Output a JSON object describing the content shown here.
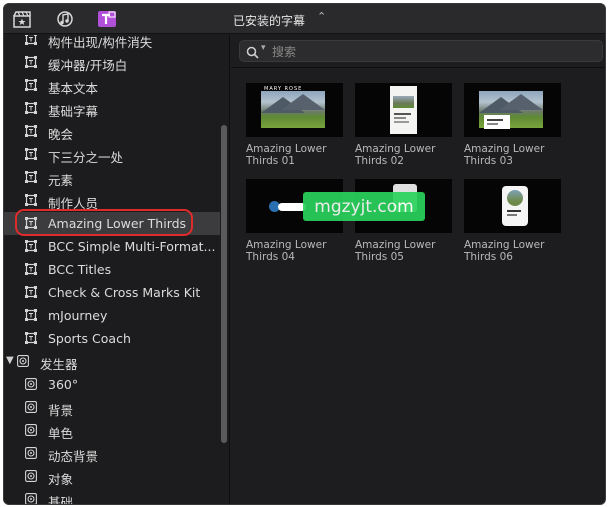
{
  "toolbar": {
    "library_title": "已安装的字幕",
    "icons": [
      "clapper-star-icon",
      "music-note-icon",
      "titles-icon"
    ],
    "active_color": "#b04fd8"
  },
  "sidebar": {
    "items": [
      {
        "label": "构件出现/构件消失",
        "icon": "title-frame-icon"
      },
      {
        "label": "缓冲器/开场白",
        "icon": "title-frame-icon"
      },
      {
        "label": "基本文本",
        "icon": "title-frame-icon"
      },
      {
        "label": "基础字幕",
        "icon": "title-frame-icon"
      },
      {
        "label": "晚会",
        "icon": "title-frame-icon"
      },
      {
        "label": "下三分之一处",
        "icon": "title-frame-icon"
      },
      {
        "label": "元素",
        "icon": "title-frame-icon"
      },
      {
        "label": "制作人员",
        "icon": "title-frame-icon"
      },
      {
        "label": "Amazing Lower Thirds",
        "icon": "title-frame-icon",
        "selected": true
      },
      {
        "label": "BCC Simple Multi-Format...",
        "icon": "title-frame-icon"
      },
      {
        "label": "BCC Titles",
        "icon": "title-frame-icon"
      },
      {
        "label": "Check & Cross Marks Kit",
        "icon": "title-frame-icon"
      },
      {
        "label": "mJourney",
        "icon": "title-frame-icon"
      },
      {
        "label": "Sports Coach",
        "icon": "title-frame-icon"
      }
    ],
    "group": {
      "label": "发生器",
      "icon": "generator-icon",
      "expanded": true
    },
    "generator_items": [
      {
        "label": "360°",
        "icon": "generator-icon"
      },
      {
        "label": "背景",
        "icon": "generator-icon"
      },
      {
        "label": "单色",
        "icon": "generator-icon"
      },
      {
        "label": "动态背景",
        "icon": "generator-icon"
      },
      {
        "label": "对象",
        "icon": "generator-icon"
      },
      {
        "label": "基础",
        "icon": "generator-icon"
      }
    ]
  },
  "search": {
    "placeholder": "搜索"
  },
  "browser": {
    "tiles": [
      {
        "name": "Amazing Lower Thirds 01",
        "thumb_label": "MARY ROSE"
      },
      {
        "name": "Amazing Lower Thirds 02"
      },
      {
        "name": "Amazing Lower Thirds 03"
      },
      {
        "name": "Amazing Lower Thirds 04"
      },
      {
        "name": "Amazing Lower Thirds 05"
      },
      {
        "name": "Amazing Lower Thirds 06"
      }
    ]
  },
  "watermark": {
    "text": "mgzyjt.com",
    "color": "#2ad35c"
  },
  "colors": {
    "background": "#1d1d1f",
    "selection": "#3c3c3e",
    "highlight_ring": "#e02b2b"
  }
}
